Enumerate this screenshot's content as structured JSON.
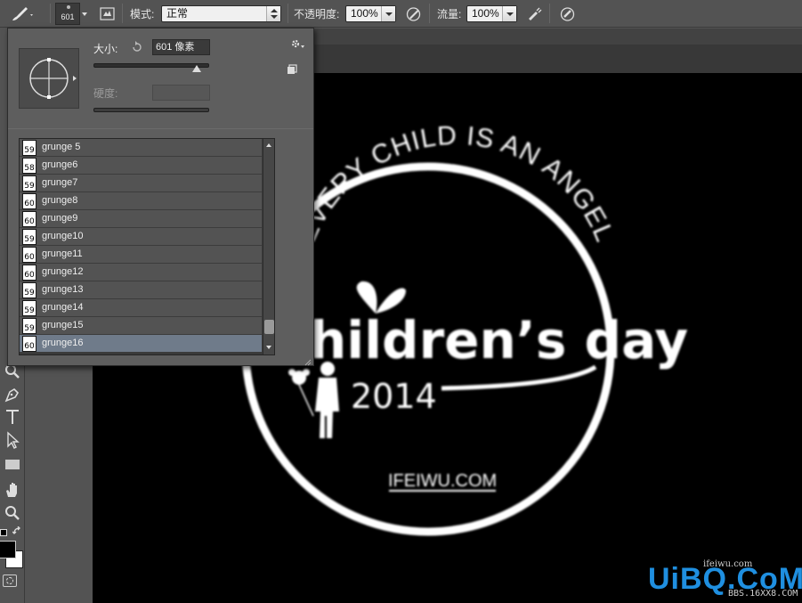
{
  "options_bar": {
    "brush_size": "601",
    "mode_label": "模式:",
    "mode_value": "正常",
    "opacity_label": "不透明度:",
    "opacity_value": "100%",
    "flow_label": "流量:",
    "flow_value": "100%"
  },
  "brush_picker": {
    "size_label": "大小:",
    "size_value": "601 像素",
    "size_fraction": 0.9,
    "hardness_label": "硬度:",
    "hardness_value": "",
    "brushes": [
      {
        "size": "59",
        "name": "grunge 5",
        "selected": false
      },
      {
        "size": "58",
        "name": "grunge6",
        "selected": false
      },
      {
        "size": "59",
        "name": "grunge7",
        "selected": false
      },
      {
        "size": "60",
        "name": "grunge8",
        "selected": false
      },
      {
        "size": "60",
        "name": "grunge9",
        "selected": false
      },
      {
        "size": "59",
        "name": "grunge10",
        "selected": false
      },
      {
        "size": "60",
        "name": "grunge11",
        "selected": false
      },
      {
        "size": "60",
        "name": "grunge12",
        "selected": false
      },
      {
        "size": "59",
        "name": "grunge13",
        "selected": false
      },
      {
        "size": "59",
        "name": "grunge14",
        "selected": false
      },
      {
        "size": "59",
        "name": "grunge15",
        "selected": false
      },
      {
        "size": "60",
        "name": "grunge16",
        "selected": true
      }
    ]
  },
  "canvas_art": {
    "arc_text": "EVERY CHILD IS AN ANGEL",
    "headline": "hildren’s day",
    "year": "2014",
    "site": "IFEIWU.COM"
  },
  "watermark": {
    "brand": "UiBQ.CoM",
    "small_text": "ifeiwu.com",
    "url": "BBS.16XX8.COM"
  },
  "colors": {
    "panel_bg": "#5e5e5e",
    "app_bg": "#535353",
    "selection": "#6f7b8a",
    "watermark_blue": "#1f8fe0"
  },
  "icons": [
    "brush-icon",
    "brush-preset-icon",
    "toggle-brush-panel-icon",
    "airbrush-icon",
    "tablet-pressure-opacity-icon",
    "tablet-pressure-size-icon",
    "gear-icon",
    "new-preset-icon",
    "reset-icon",
    "pen-icon",
    "type-icon",
    "path-select-icon",
    "rectangle-icon",
    "hand-icon",
    "zoom-icon"
  ]
}
